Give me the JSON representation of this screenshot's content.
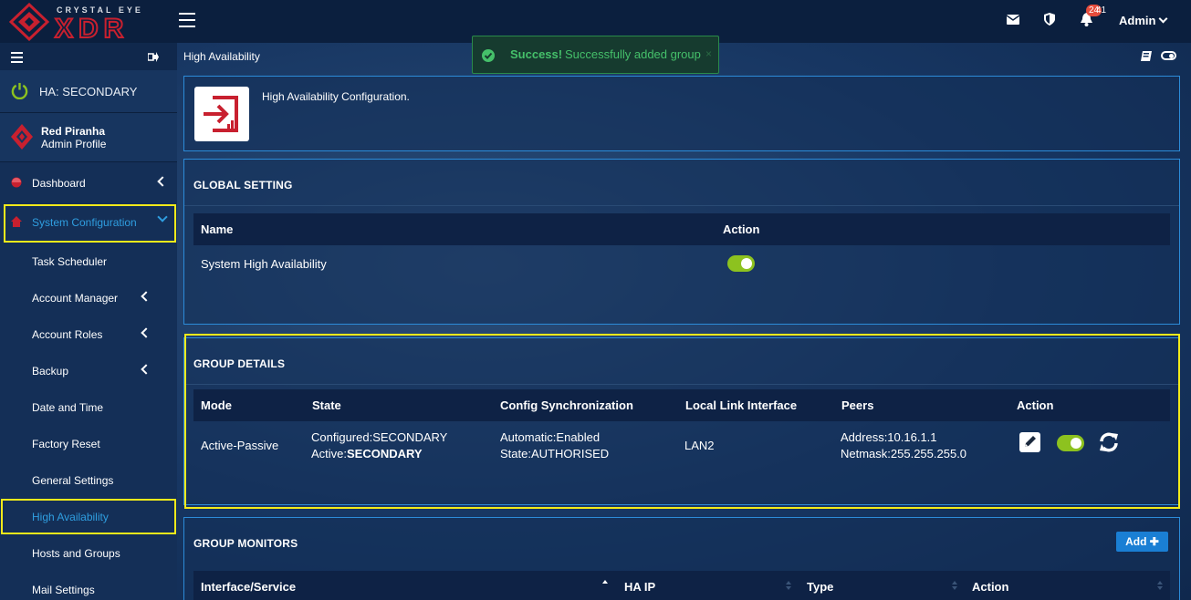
{
  "topbar": {
    "logo_sub": "CRYSTAL EYE",
    "logo_main": "XDR",
    "notif_badge": "24",
    "notif_badge_tail": "41",
    "admin_label": "Admin"
  },
  "sidebar": {
    "ha_status": "HA: SECONDARY",
    "profile_name": "Red Piranha",
    "profile_role": "Admin Profile",
    "items": [
      {
        "label": "Dashboard"
      },
      {
        "label": "System Configuration"
      },
      {
        "label": "Task Scheduler"
      },
      {
        "label": "Account Manager"
      },
      {
        "label": "Account Roles"
      },
      {
        "label": "Backup"
      },
      {
        "label": "Date and Time"
      },
      {
        "label": "Factory Reset"
      },
      {
        "label": "General Settings"
      },
      {
        "label": "High Availability"
      },
      {
        "label": "Hosts and Groups"
      },
      {
        "label": "Mail Settings"
      }
    ]
  },
  "main": {
    "page_title": "High Availability",
    "toast": {
      "strong": "Success!",
      "message": "Successfully added group",
      "close": "×"
    },
    "intro_text": "High Availability Configuration.",
    "global": {
      "heading": "GLOBAL SETTING",
      "col_name": "Name",
      "col_action": "Action",
      "row_name": "System High Availability"
    },
    "group": {
      "heading": "GROUP DETAILS",
      "cols": [
        "Mode",
        "State",
        "Config Synchronization",
        "Local Link Interface",
        "Peers",
        "Action"
      ],
      "row": {
        "mode": "Active-Passive",
        "state_line1": "Configured:SECONDARY",
        "state_line2_label": "Active:",
        "state_line2_value": "SECONDARY",
        "sync_line1": "Automatic:Enabled",
        "sync_line2": "State:AUTHORISED",
        "interface": "LAN2",
        "peers_line1": "Address:10.16.1.1",
        "peers_line2": "Netmask:255.255.255.0"
      }
    },
    "monitors": {
      "heading": "GROUP MONITORS",
      "add_label": "Add",
      "cols": [
        "Interface/Service",
        "HA IP",
        "Type",
        "Action"
      ]
    }
  },
  "colors": {
    "accent_blue": "#2f9ee0",
    "highlight_yellow": "#f2ea1a",
    "toggle_green": "#8dc21f",
    "brand_red": "#c8202f",
    "success_green": "#45c06a"
  }
}
